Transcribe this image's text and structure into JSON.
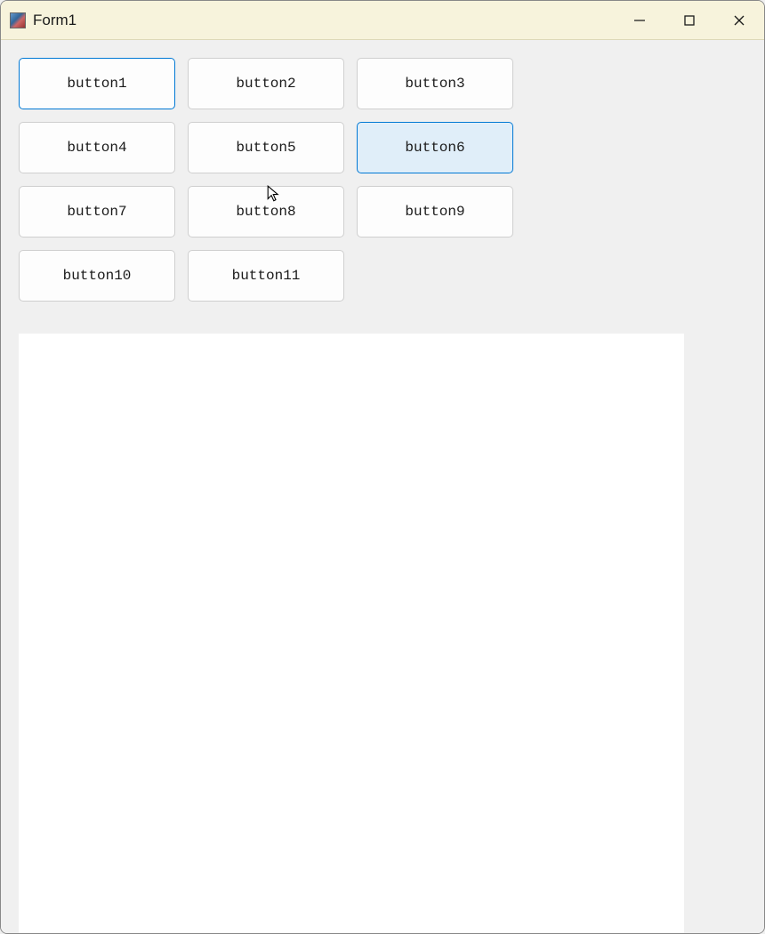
{
  "window": {
    "title": "Form1"
  },
  "buttons": [
    {
      "label": "button1",
      "state": "focused"
    },
    {
      "label": "button2",
      "state": "normal"
    },
    {
      "label": "button3",
      "state": "normal"
    },
    {
      "label": "button4",
      "state": "normal"
    },
    {
      "label": "button5",
      "state": "normal"
    },
    {
      "label": "button6",
      "state": "hovered"
    },
    {
      "label": "button7",
      "state": "normal"
    },
    {
      "label": "button8",
      "state": "normal"
    },
    {
      "label": "button9",
      "state": "normal"
    },
    {
      "label": "button10",
      "state": "normal"
    },
    {
      "label": "button11",
      "state": "normal"
    }
  ]
}
